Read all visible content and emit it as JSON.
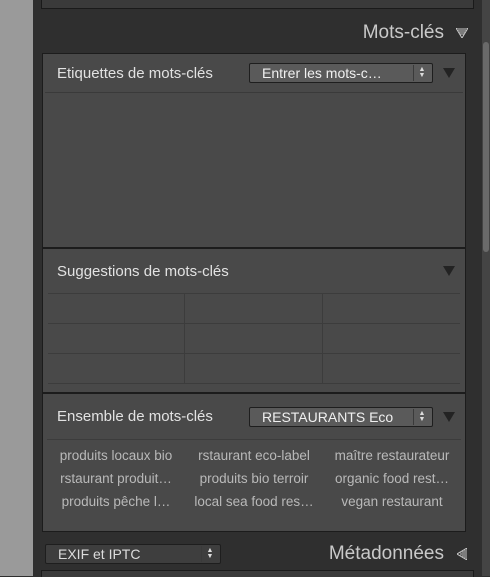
{
  "keywords_panel": {
    "title": "Mots-clés",
    "header_icon": "triangle-down-icon"
  },
  "keyword_tags": {
    "title": "Etiquettes de mots-clés",
    "select_value": "Entrer les mots-c…"
  },
  "keyword_suggestions": {
    "title": "Suggestions de mots-clés"
  },
  "keyword_set": {
    "title": "Ensemble de mots-clés",
    "select_value": "RESTAURANTS Eco",
    "keywords": [
      "produits locaux bio",
      "rstaurant eco-label",
      "maître restaurateur",
      "rstaurant produit…",
      "produits bio terroir",
      "organic food rest…",
      "produits pêche l…",
      "local sea food res…",
      "vegan restaurant"
    ]
  },
  "metadata_panel": {
    "select_value": "EXIF et IPTC",
    "title": "Métadonnées",
    "header_icon": "triangle-left-icon"
  }
}
